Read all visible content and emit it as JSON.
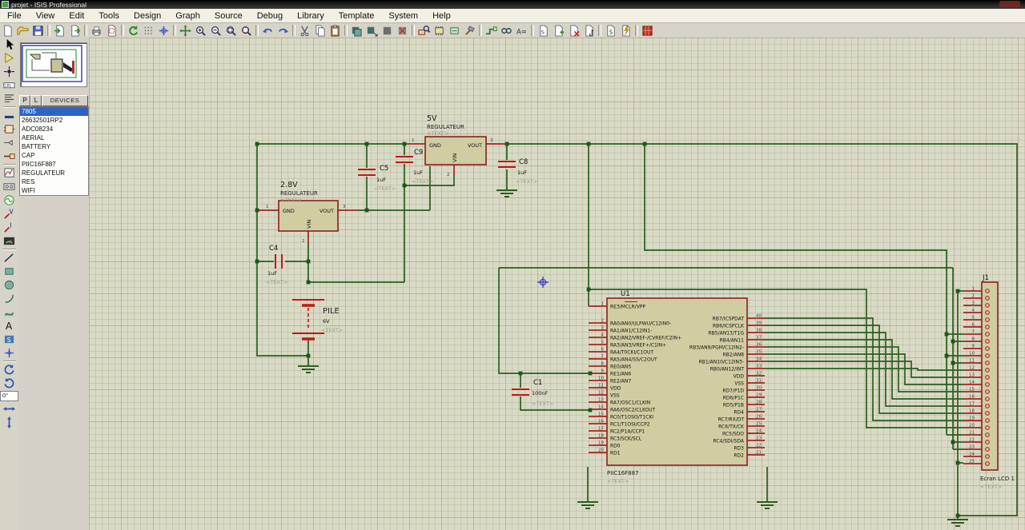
{
  "window": {
    "title": "projet - ISIS Professional"
  },
  "menu": {
    "items": [
      "File",
      "View",
      "Edit",
      "Tools",
      "Design",
      "Graph",
      "Source",
      "Debug",
      "Library",
      "Template",
      "System",
      "Help"
    ]
  },
  "toolbar": {
    "items": [
      "new-design",
      "open-design",
      "save-design",
      "import-section",
      "export-section",
      "print",
      "mark-output-area",
      "redraw",
      "toggle-grid",
      "toggle-false-origin",
      "center-at-cursor",
      "zoom-in",
      "zoom-out",
      "zoom-all",
      "zoom-area",
      "undo",
      "redo",
      "cut",
      "copy",
      "paste",
      "block-copy",
      "block-move",
      "block-rotate",
      "block-delete",
      "pick-device",
      "make-device",
      "packaging-tool",
      "decompose",
      "wire-autorouter",
      "search-tag",
      "property-assignment",
      "design-explorer",
      "new-sheet",
      "remove-sheet",
      "zoom-to-sheet",
      "bill-of-materials",
      "electrical-rule-check",
      "netlist-to-ares"
    ]
  },
  "side_toolbar": {
    "items": [
      "selection-pointer",
      "component-mode",
      "junction-dot-mode",
      "wire-label-mode",
      "text-script-mode",
      "bus-mode",
      "subcircuit-mode",
      "terminal-mode",
      "device-pin-mode",
      "graph-mode",
      "tape-recorder-mode",
      "generator-mode",
      "voltage-probe-mode",
      "current-probe-mode",
      "virtual-instrument-mode",
      "line-tool",
      "box-tool",
      "circle-tool",
      "arc-tool",
      "path-tool",
      "text-tool",
      "symbol-tool",
      "marker-tool",
      "rotate-clockwise",
      "rotate-anticlockwise"
    ],
    "items_after_angle": [
      "mirror-horizontal",
      "mirror-vertical"
    ],
    "rotation_angle": "0°"
  },
  "devices_panel": {
    "pick_button": "P",
    "library_button": "L",
    "header": "DEVICES",
    "items": [
      {
        "label": "7805",
        "selected": true
      },
      {
        "label": "26632501RP2",
        "selected": false
      },
      {
        "label": "ADC08234",
        "selected": false
      },
      {
        "label": "AERIAL",
        "selected": false
      },
      {
        "label": "BATTERY",
        "selected": false
      },
      {
        "label": "CAP",
        "selected": false
      },
      {
        "label": "PIIC16F887",
        "selected": false
      },
      {
        "label": "REGULATEUR",
        "selected": false
      },
      {
        "label": "RES",
        "selected": false
      },
      {
        "label": "WIFI",
        "selected": false
      }
    ]
  },
  "schematic": {
    "regulator_5v": {
      "title": "5V",
      "type_label": "REGULATEUR",
      "text": "<TEXT>",
      "pin_gnd": "GND",
      "pin_vout": "VOUT",
      "pin_vin": "VIN",
      "num_gnd": "1",
      "num_vout": "3",
      "num_vin": "2"
    },
    "regulator_2v8": {
      "title": "2.8V",
      "type_label": "REGULATEUR",
      "text": "<TEXT>",
      "pin_gnd": "GND",
      "pin_vout": "VOUT",
      "pin_vin": "VIN",
      "num_gnd": "1",
      "num_vout": "3",
      "num_vin": "2"
    },
    "c4": {
      "ref": "C4",
      "value": "1uF",
      "text": "<TEXT>"
    },
    "c5": {
      "ref": "C5",
      "value": "1uF",
      "text": "<TEXT>"
    },
    "c8": {
      "ref": "C8",
      "value": "1uF",
      "text": "<TEXT>"
    },
    "c9": {
      "ref": "C9",
      "value": "1uF",
      "text": "<TEXT>"
    },
    "c1": {
      "ref": "C1",
      "value": "100nF",
      "text": "<TEXT>"
    },
    "battery": {
      "ref": "PILE",
      "value": "6V",
      "text": "<TEXT>"
    },
    "u1": {
      "ref": "U1",
      "device": "PIIC16F887",
      "text": "<TEXT>",
      "left_pins": [
        [
          "1",
          "RE3/MCLR/VPP"
        ],
        [
          "2",
          "RA0/AN0/ULPWU/C12IN0-"
        ],
        [
          "3",
          "RA1/AN1/C12IN1-"
        ],
        [
          "4",
          "RA2/AN2/VREF-/CVREF/C2IN+"
        ],
        [
          "5",
          "RA3/AN3/VREF+/C1IN+"
        ],
        [
          "6",
          "RA4/T0CKI/C1OUT"
        ],
        [
          "7",
          "RA5/AN4/SS/C2OUT"
        ],
        [
          "8",
          "RE0/AN5"
        ],
        [
          "9",
          "RE1/AN6"
        ],
        [
          "10",
          "RE2/AN7"
        ],
        [
          "11",
          "VDD"
        ],
        [
          "12",
          "VSS"
        ],
        [
          "13",
          "RA7/OSC1/CLKIN"
        ],
        [
          "14",
          "RA6/OSC2/CLKOUT"
        ],
        [
          "15",
          "RC0/T1OSO/T1CKI"
        ],
        [
          "16",
          "RC1/T1OSI/CCP2"
        ],
        [
          "17",
          "RC2/P1A/CCP1"
        ],
        [
          "18",
          "RC3/SCK/SCL"
        ],
        [
          "19",
          "RD0"
        ],
        [
          "20",
          "RD1"
        ]
      ],
      "right_pins": [
        [
          "40",
          "RB7/ICSPDAT"
        ],
        [
          "39",
          "RB6/ICSPCLK"
        ],
        [
          "38",
          "RB5/AN13/T1G"
        ],
        [
          "37",
          "RB4/AN11"
        ],
        [
          "36",
          "RB3/AN9/PGM/C12IN2-"
        ],
        [
          "35",
          "RB2/AN8"
        ],
        [
          "34",
          "RB1/AN10/C12IN3-"
        ],
        [
          "33",
          "RB0/AN12/INT"
        ],
        [
          "32",
          "VDD"
        ],
        [
          "31",
          "VSS"
        ],
        [
          "30",
          "RD7/P1D"
        ],
        [
          "29",
          "RD6/P1C"
        ],
        [
          "28",
          "RD5/P1B"
        ],
        [
          "27",
          "RD4"
        ],
        [
          "26",
          "RC7/RX/DT"
        ],
        [
          "25",
          "RC6/TX/CK"
        ],
        [
          "24",
          "RC5/SDO"
        ],
        [
          "23",
          "RC4/SDI/SDA"
        ],
        [
          "22",
          "RD3"
        ],
        [
          "21",
          "RD2"
        ]
      ]
    },
    "j1": {
      "ref": "J1",
      "label": "Ecran LCD 1",
      "text": "<TEXT>",
      "pins": [
        "1",
        "2",
        "3",
        "4",
        "5",
        "6",
        "7",
        "8",
        "9",
        "10",
        "11",
        "12",
        "13",
        "14",
        "15",
        "16",
        "17",
        "18",
        "19",
        "20",
        "21",
        "22",
        "23",
        "24",
        "25"
      ]
    }
  }
}
